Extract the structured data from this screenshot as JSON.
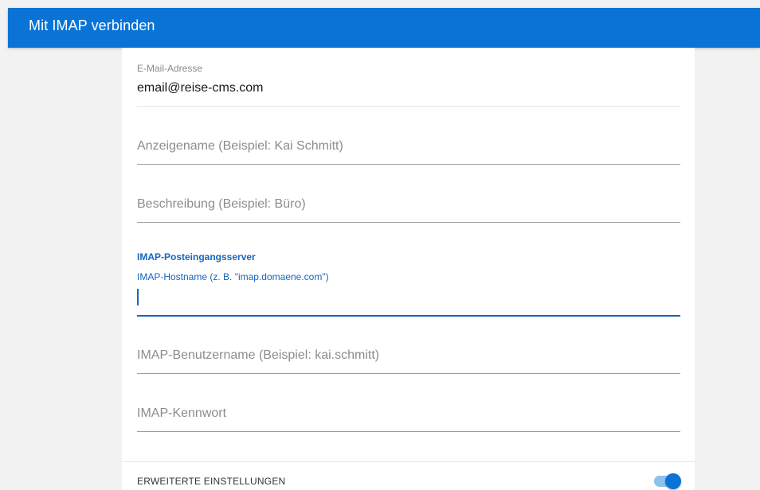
{
  "header": {
    "title": "Mit IMAP verbinden"
  },
  "email": {
    "label": "E-Mail-Adresse",
    "value": "email@reise-cms.com"
  },
  "display_name": {
    "placeholder": "Anzeigename (Beispiel: Kai Schmitt)"
  },
  "description": {
    "placeholder": "Beschreibung (Beispiel: Büro)"
  },
  "imap_section": {
    "title": "IMAP-Posteingangsserver",
    "hostname_label": "IMAP-Hostname (z. B. \"imap.domaene.com\")",
    "hostname_value": ""
  },
  "imap_username": {
    "placeholder": "IMAP-Benutzername (Beispiel: kai.schmitt)"
  },
  "imap_password": {
    "placeholder": "IMAP-Kennwort"
  },
  "advanced": {
    "label": "ERWEITERTE EINSTELLUNGEN",
    "toggle_on": true
  },
  "colors": {
    "accent": "#0a74d6",
    "active_field": "#1565c0",
    "background": "#f2f2f2"
  }
}
